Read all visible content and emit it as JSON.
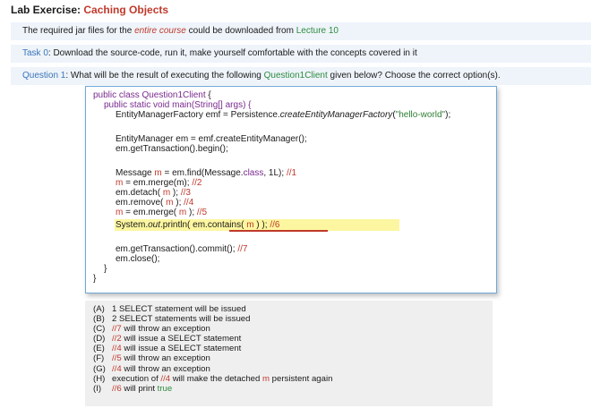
{
  "title": {
    "prefix": "Lab Exercise: ",
    "highlight": "Caching Objects"
  },
  "banner1": {
    "a": "The required jar files for the ",
    "b": "entire course",
    "c": " could be downloaded from ",
    "d": "Lecture 10"
  },
  "banner2": {
    "a": "Task ",
    "b": "0",
    "c": ": Download the source-code, run it, make yourself comfortable with the concepts covered in it"
  },
  "banner3": {
    "a": "Question 1",
    "b": ": What will be the result of executing the following ",
    "c": "Question1Client",
    "d": " given below? Choose the correct option(s)."
  },
  "code": {
    "l1a": "public class ",
    "l1b": "Question1Client",
    "l1c": " {",
    "l2": "public static void main(String[] args) {",
    "l3a": "EntityManagerFactory emf = Persistence.",
    "l3b": "createEntityManagerFactory",
    "l3c": "(",
    "l3d": "\"hello-world\"",
    "l3e": ");",
    "l4": "EntityManager em = emf.createEntityManager();",
    "l5": "em.getTransaction().begin();",
    "l6a": "Message ",
    "l6b": "m",
    "l6c": " = em.find(Message.",
    "l6d": "class",
    "l6e": ", 1L); ",
    "l6f": "//1",
    "l7a": "m",
    "l7b": " = em.merge(m); ",
    "l7c": "//2",
    "l8a": "em.detach( ",
    "l8b": "m",
    "l8c": " ); ",
    "l8d": "//3",
    "l9a": "em.remove( ",
    "l9b": "m",
    "l9c": " ); ",
    "l9d": "//4",
    "l10a": "m",
    "l10b": " = em.merge( ",
    "l10c": "m",
    "l10d": " ); ",
    "l10e": "//5",
    "l11a": "System.",
    "l11b": "out",
    "l11c": ".println( em.contains( ",
    "l11d": "m",
    "l11e": " ) ); ",
    "l11f": "//6",
    "l12a": "em.getTransaction().commit(); ",
    "l12b": "//7",
    "l13": "em.close();",
    "l14": "}",
    "l15": "}"
  },
  "options": [
    {
      "label": "(A)",
      "parts": [
        "1 SELECT statement will be issued"
      ]
    },
    {
      "label": "(B)",
      "parts": [
        "2 SELECT statements will be issued"
      ]
    },
    {
      "label": "(C)",
      "c1": "//7",
      "parts": [
        " will throw an exception"
      ]
    },
    {
      "label": "(D)",
      "c1": "//2",
      "parts": [
        " will issue a SELECT statement"
      ]
    },
    {
      "label": "(E)",
      "c1": "//4",
      "parts": [
        " will issue a SELECT statement"
      ]
    },
    {
      "label": "(F)",
      "c1": "//5",
      "parts": [
        " will throw an exception"
      ]
    },
    {
      "label": "(G)",
      "c1": "//4",
      "parts": [
        " will throw an exception"
      ]
    },
    {
      "label": "(H)",
      "pre": "execution of ",
      "c1": "//4",
      "mid": " will make the detached ",
      "c2": "m",
      "parts": [
        " persistent again"
      ]
    },
    {
      "label": "(I)",
      "c1": "//6",
      "parts": [
        " will print "
      ],
      "green": "true"
    }
  ]
}
